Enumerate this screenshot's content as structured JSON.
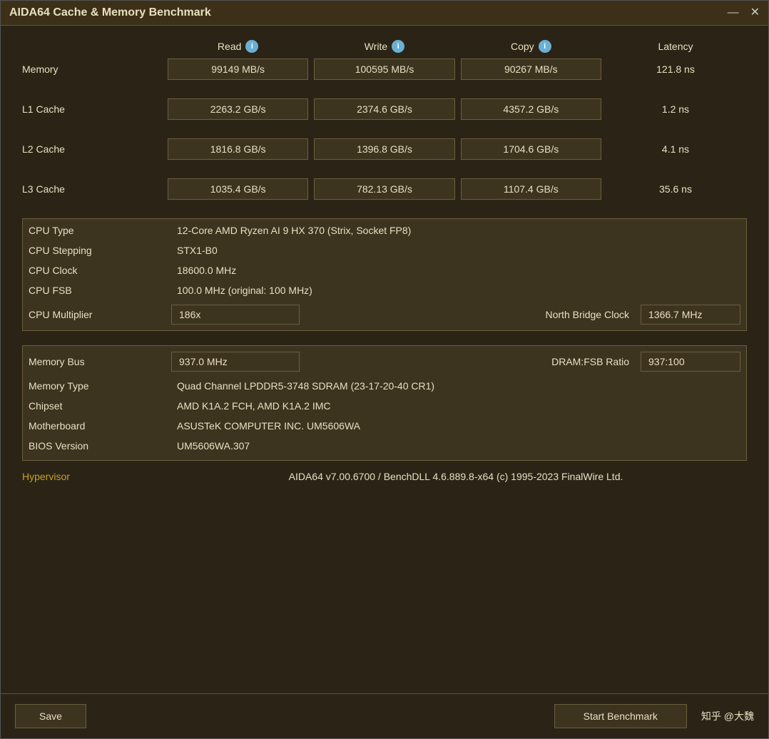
{
  "window": {
    "title": "AIDA64 Cache & Memory Benchmark",
    "minimize_label": "—",
    "close_label": "✕"
  },
  "columns": {
    "label_empty": "",
    "read": "Read",
    "write": "Write",
    "copy": "Copy",
    "latency": "Latency"
  },
  "rows": {
    "memory": {
      "label": "Memory",
      "read": "99149 MB/s",
      "write": "100595 MB/s",
      "copy": "90267 MB/s",
      "latency": "121.8 ns"
    },
    "l1": {
      "label": "L1 Cache",
      "read": "2263.2 GB/s",
      "write": "2374.6 GB/s",
      "copy": "4357.2 GB/s",
      "latency": "1.2 ns"
    },
    "l2": {
      "label": "L2 Cache",
      "read": "1816.8 GB/s",
      "write": "1396.8 GB/s",
      "copy": "1704.6 GB/s",
      "latency": "4.1 ns"
    },
    "l3": {
      "label": "L3 Cache",
      "read": "1035.4 GB/s",
      "write": "782.13 GB/s",
      "copy": "1107.4 GB/s",
      "latency": "35.6 ns"
    }
  },
  "cpu_info": {
    "cpu_type_label": "CPU Type",
    "cpu_type_value": "12-Core AMD Ryzen AI 9 HX 370  (Strix, Socket FP8)",
    "cpu_stepping_label": "CPU Stepping",
    "cpu_stepping_value": "STX1-B0",
    "cpu_clock_label": "CPU Clock",
    "cpu_clock_value": "18600.0 MHz",
    "cpu_fsb_label": "CPU FSB",
    "cpu_fsb_value": "100.0 MHz  (original: 100 MHz)",
    "cpu_multiplier_label": "CPU Multiplier",
    "cpu_multiplier_value": "186x",
    "north_bridge_clock_label": "North Bridge Clock",
    "north_bridge_clock_value": "1366.7 MHz"
  },
  "memory_info": {
    "memory_bus_label": "Memory Bus",
    "memory_bus_value": "937.0 MHz",
    "dram_fsb_label": "DRAM:FSB Ratio",
    "dram_fsb_value": "937:100",
    "memory_type_label": "Memory Type",
    "memory_type_value": "Quad Channel LPDDR5-3748 SDRAM  (23-17-20-40 CR1)",
    "chipset_label": "Chipset",
    "chipset_value": "AMD K1A.2 FCH, AMD K1A.2 IMC",
    "motherboard_label": "Motherboard",
    "motherboard_value": "ASUSTeK COMPUTER INC. UM5606WA",
    "bios_label": "BIOS Version",
    "bios_value": "UM5606WA.307"
  },
  "hypervisor": {
    "label": "Hypervisor",
    "value": "AIDA64 v7.00.6700 / BenchDLL 4.6.889.8-x64  (c) 1995-2023 FinalWire Ltd."
  },
  "footer": {
    "save_label": "Save",
    "start_benchmark_label": "Start Benchmark",
    "watermark": "知乎 @大魏"
  }
}
